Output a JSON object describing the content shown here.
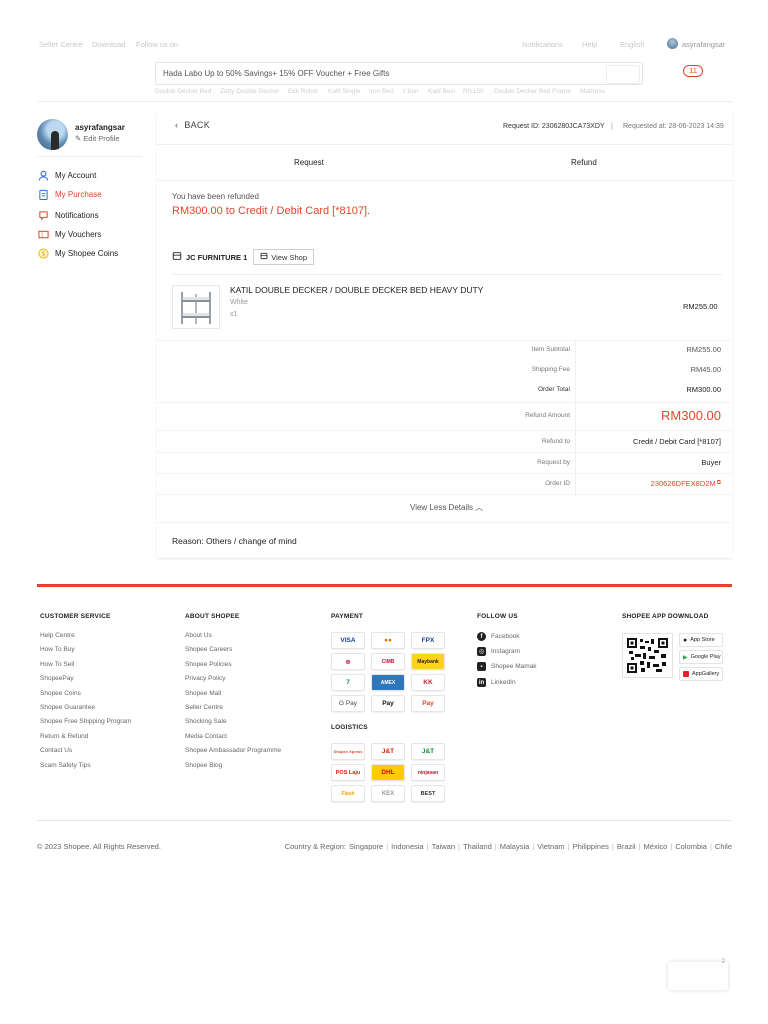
{
  "topbar": {
    "left_links": [
      "Seller Centre",
      "Download",
      "Follow us on"
    ],
    "right_links": [
      "Notifications",
      "Help",
      "English"
    ],
    "username": "asyrafangsar"
  },
  "search": {
    "placeholder": "Hada Labo Up to 50% Savings+ 15% OFF Voucher + Free Gifts",
    "cart_count": "11",
    "suggestions": [
      "Double Decker Bed",
      "Zetty Double Decker",
      "Etik Robot",
      "Katil Single",
      "Iron Bed",
      "Y1lun",
      "Katil Besi",
      "Rfs150",
      "Double Decker Bed Frame",
      "Mattress"
    ]
  },
  "sidebar": {
    "username": "asyrafangsar",
    "edit_profile": "Edit Profile",
    "items": [
      {
        "label": "My Account",
        "icon": "user-icon"
      },
      {
        "label": "My Purchase",
        "icon": "clipboard-icon"
      },
      {
        "label": "Notifications",
        "icon": "bell-icon"
      },
      {
        "label": "My Vouchers",
        "icon": "voucher-icon"
      },
      {
        "label": "My Shopee Coins",
        "icon": "coin-icon"
      }
    ]
  },
  "detail": {
    "back": "BACK",
    "request_id": "Request ID: 2306280JCA73XDY",
    "separator": "|",
    "requested_at": "Requested at: 28-06-2023 14:39",
    "tabs": [
      "Request",
      "Refund"
    ],
    "refund_status": "You have been refunded",
    "refund_headline": "RM300.00 to Credit / Debit Card [*8107].",
    "shop_name": "JC FURNITURE 1",
    "view_shop": "View Shop",
    "product": {
      "title": "KATIL DOUBLE DECKER / DOUBLE DECKER BED HEAVY DUTY",
      "variation": "White",
      "quantity": "x1",
      "price": "RM255.00"
    },
    "summary": [
      {
        "label": "Item Subtotal",
        "value": "RM255.00"
      },
      {
        "label": "Shipping Fee",
        "value": "RM45.00"
      },
      {
        "label": "Order Total",
        "value": "RM300.00"
      },
      {
        "label": "Refund Amount",
        "value": "RM300.00"
      },
      {
        "label": "Refund to",
        "value": "Credit / Debit Card [*8107]"
      },
      {
        "label": "Request by",
        "value": "Buyer"
      },
      {
        "label": "Order ID",
        "value": "230626DFEX8D2M"
      }
    ],
    "view_less": "View Less Details",
    "reason": "Reason: Others / change of mind"
  },
  "footer": {
    "customer_service": {
      "heading": "CUSTOMER SERVICE",
      "links": [
        "Help Centre",
        "How To Buy",
        "How To Sell",
        "ShopeePay",
        "Shopee Coins",
        "Shopee Guarantee",
        "Shopee Free Shipping Program",
        "Return & Refund",
        "Contact Us",
        "Scam Safety Tips"
      ]
    },
    "about": {
      "heading": "ABOUT SHOPEE",
      "links": [
        "About Us",
        "Shopee Careers",
        "Shopee Policies",
        "Privacy Policy",
        "Shopee Mall",
        "Seller Centre",
        "Shocking Sale",
        "Media Contact",
        "Shopee Ambassador Programme",
        "Shopee Blog"
      ]
    },
    "payment": {
      "heading": "PAYMENT",
      "methods": [
        "VISA",
        "●●",
        "FPX",
        "⊕",
        "CIMB",
        "Maybank",
        "7",
        "AMEX",
        "KK",
        "G Pay",
        " Pay",
        "Pay"
      ]
    },
    "logistics": {
      "heading": "LOGISTICS",
      "carriers": [
        "Shopee Xpress",
        "J&T",
        "J&T",
        "POS Laju",
        "DHL",
        "ninjavan",
        "Flash",
        "KEX",
        "BEST"
      ]
    },
    "follow": {
      "heading": "FOLLOW US",
      "links": [
        "Facebook",
        "Instagram",
        "Shopee Mamak",
        "LinkedIn"
      ]
    },
    "app": {
      "heading": "SHOPEE APP DOWNLOAD",
      "stores": [
        "App Store",
        "Google Play",
        "AppGallery"
      ]
    },
    "copyright": "© 2023 Shopee. All Rights Reserved.",
    "regions_label": "Country & Region:",
    "regions": [
      "Singapore",
      "Indonesia",
      "Taiwan",
      "Thailand",
      "Malaysia",
      "Vietnam",
      "Philippines",
      "Brazil",
      "México",
      "Colombia",
      "Chile"
    ]
  },
  "chat_badge": "2",
  "colors": {
    "accent": "#e0472a"
  }
}
